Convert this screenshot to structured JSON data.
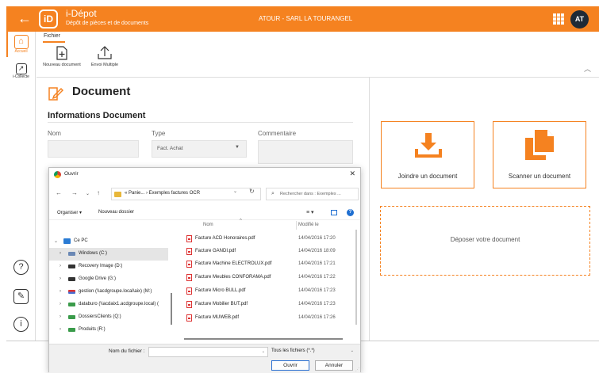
{
  "header": {
    "back_icon": "arrow-left-icon",
    "logo_text": "iD",
    "app_name": "i-Dépot",
    "app_subtitle": "Dépôt de pièces et de documents",
    "company": "ATOUR - SARL LA TOURANGEL",
    "apps_icon": "grid-icon",
    "avatar_initials": "AT",
    "brand_color": "#f58220"
  },
  "rail": {
    "items": [
      {
        "label": "Accueil",
        "icon": "home-icon",
        "active": true
      },
      {
        "label": "i-Collecte",
        "icon": "arrow-up-right-icon",
        "active": false
      }
    ],
    "bottom_icons": [
      "help-icon",
      "chat-icon",
      "info-icon"
    ]
  },
  "ribbon": {
    "tab": "Fichier",
    "buttons": [
      {
        "label": "Nouveau document",
        "icon": "new-document-icon"
      },
      {
        "label": "Envoi Multiple",
        "icon": "upload-icon"
      }
    ]
  },
  "document": {
    "title": "Document",
    "section": "Informations Document",
    "fields": {
      "nom_label": "Nom",
      "nom_value": "",
      "type_label": "Type",
      "type_value": "Fact. Achat",
      "commentaire_label": "Commentaire",
      "commentaire_value": ""
    }
  },
  "actions": {
    "join_label": "Joindre un document",
    "scan_label": "Scanner un document",
    "drop_label": "Déposer votre document"
  },
  "dialog": {
    "title": "Ouvrir",
    "path": "« Panie... › Exemples factures OCR",
    "search_placeholder": "Rechercher dans : Exemples ...",
    "organize": "Organiser ▾",
    "new_folder": "Nouveau dossier",
    "tree": [
      {
        "label": "Ce PC",
        "caret": "⌄",
        "indent": 0,
        "icon": "pc"
      },
      {
        "label": "Windows (C:)",
        "caret": "›",
        "indent": 1,
        "icon": "drive",
        "selected": true
      },
      {
        "label": "Recovery Image (D:)",
        "caret": "›",
        "indent": 1,
        "icon": "drive"
      },
      {
        "label": "Google Drive (G:)",
        "caret": "›",
        "indent": 1,
        "icon": "drive"
      },
      {
        "label": "gestion (\\\\acdgroupe.local\\aix) (M:)",
        "caret": "›",
        "indent": 1,
        "icon": "net-red"
      },
      {
        "label": "databuro (\\\\acdaix1.acdgroupe.local) (",
        "caret": "›",
        "indent": 1,
        "icon": "net-green"
      },
      {
        "label": "DossiersClients (Q:)",
        "caret": "›",
        "indent": 1,
        "icon": "net-green"
      },
      {
        "label": "Produits (R:)",
        "caret": "›",
        "indent": 1,
        "icon": "net-green"
      }
    ],
    "columns": {
      "name": "Nom",
      "modified": "Modifié le"
    },
    "files": [
      {
        "name": "Facture ACD Honoraires.pdf",
        "date": "14/04/2016 17:20"
      },
      {
        "name": "Facture GANDI.pdf",
        "date": "14/04/2016 18:09"
      },
      {
        "name": "Facture Machine ELECTROLUX.pdf",
        "date": "14/04/2016 17:21"
      },
      {
        "name": "Facture Meubles CONFORAMA.pdf",
        "date": "14/04/2016 17:22"
      },
      {
        "name": "Facture Micro BULL.pdf",
        "date": "14/04/2016 17:23"
      },
      {
        "name": "Facture Mobilier BUT.pdf",
        "date": "14/04/2016 17:23"
      },
      {
        "name": "Facture MUWEB.pdf",
        "date": "14/04/2016 17:26"
      }
    ],
    "filename_label": "Nom du fichier :",
    "filename_value": "",
    "filetype": "Tous les fichiers (*.*)",
    "open_button": "Ouvrir",
    "cancel_button": "Annuler"
  }
}
